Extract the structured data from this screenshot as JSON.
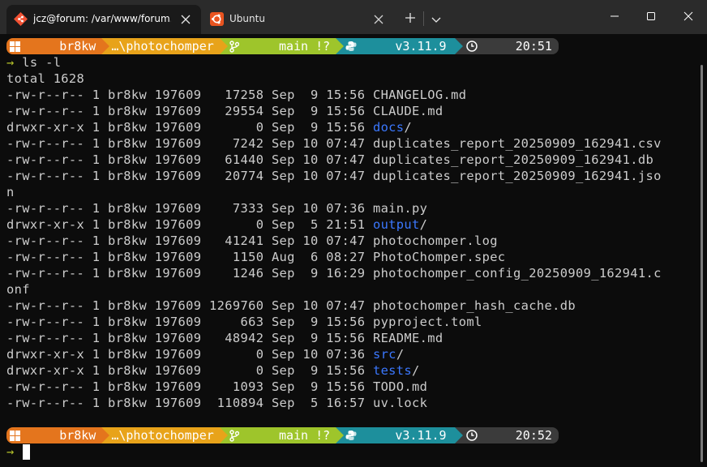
{
  "window": {
    "tabs": [
      {
        "title": "jcz@forum: /var/www/forum.",
        "icon": "git-bash-icon"
      },
      {
        "title": "Ubuntu",
        "icon": "ubuntu-icon"
      }
    ]
  },
  "prompt1": {
    "user": "br8kw",
    "path": "…\\photochomper",
    "branch": "main !?",
    "python": "v3.11.9",
    "time": "20:51"
  },
  "prompt2": {
    "user": "br8kw",
    "path": "…\\photochomper",
    "branch": "main !?",
    "python": "v3.11.9",
    "time": "20:52"
  },
  "command": {
    "chevron": "→",
    "text": "ls -l"
  },
  "total": "total 1628",
  "listing": [
    {
      "meta": "-rw-r--r-- 1 br8kw 197609   17258 Sep  9 15:56 ",
      "name": "CHANGELOG.md",
      "suffix": ""
    },
    {
      "meta": "-rw-r--r-- 1 br8kw 197609   29554 Sep  9 15:56 ",
      "name": "CLAUDE.md",
      "suffix": ""
    },
    {
      "meta": "drwxr-xr-x 1 br8kw 197609       0 Sep  9 15:56 ",
      "name": "docs",
      "suffix": "/",
      "dir": true
    },
    {
      "meta": "-rw-r--r-- 1 br8kw 197609    7242 Sep 10 07:47 ",
      "name": "duplicates_report_20250909_162941.csv",
      "suffix": ""
    },
    {
      "meta": "-rw-r--r-- 1 br8kw 197609   61440 Sep 10 07:47 ",
      "name": "duplicates_report_20250909_162941.db",
      "suffix": ""
    },
    {
      "meta": "-rw-r--r-- 1 br8kw 197609   20774 Sep 10 07:47 ",
      "name": "duplicates_report_20250909_162941.jso",
      "suffix": ""
    },
    {
      "meta": "",
      "name": "n",
      "suffix": "",
      "wrap": true
    },
    {
      "meta": "-rw-r--r-- 1 br8kw 197609    7333 Sep 10 07:36 ",
      "name": "main.py",
      "suffix": ""
    },
    {
      "meta": "drwxr-xr-x 1 br8kw 197609       0 Sep  5 21:51 ",
      "name": "output",
      "suffix": "/",
      "dir": true
    },
    {
      "meta": "-rw-r--r-- 1 br8kw 197609   41241 Sep 10 07:47 ",
      "name": "photochomper.log",
      "suffix": ""
    },
    {
      "meta": "-rw-r--r-- 1 br8kw 197609    1150 Aug  6 08:27 ",
      "name": "PhotoChomper.spec",
      "suffix": ""
    },
    {
      "meta": "-rw-r--r-- 1 br8kw 197609    1246 Sep  9 16:29 ",
      "name": "photochomper_config_20250909_162941.c",
      "suffix": ""
    },
    {
      "meta": "",
      "name": "onf",
      "suffix": "",
      "wrap": true
    },
    {
      "meta": "-rw-r--r-- 1 br8kw 197609 1269760 Sep 10 07:47 ",
      "name": "photochomper_hash_cache.db",
      "suffix": ""
    },
    {
      "meta": "-rw-r--r-- 1 br8kw 197609     663 Sep  9 15:56 ",
      "name": "pyproject.toml",
      "suffix": ""
    },
    {
      "meta": "-rw-r--r-- 1 br8kw 197609   48942 Sep  9 15:56 ",
      "name": "README.md",
      "suffix": ""
    },
    {
      "meta": "drwxr-xr-x 1 br8kw 197609       0 Sep 10 07:36 ",
      "name": "src",
      "suffix": "/",
      "dir": true
    },
    {
      "meta": "drwxr-xr-x 1 br8kw 197609       0 Sep  9 15:56 ",
      "name": "tests",
      "suffix": "/",
      "dir": true
    },
    {
      "meta": "-rw-r--r-- 1 br8kw 197609    1093 Sep  9 15:56 ",
      "name": "TODO.md",
      "suffix": ""
    },
    {
      "meta": "-rw-r--r-- 1 br8kw 197609  110894 Sep  5 16:57 ",
      "name": "uv.lock",
      "suffix": ""
    }
  ],
  "colors": {
    "background": "#0c0c0c",
    "text": "#cccccc",
    "directory": "#3b78ff",
    "prompt_user": "#e4751d",
    "prompt_path": "#e8a31a",
    "prompt_git": "#9ec52b",
    "prompt_python": "#1d8f9c",
    "prompt_time": "#3b3b3b",
    "prompt_chevron": "#b5c22a"
  }
}
